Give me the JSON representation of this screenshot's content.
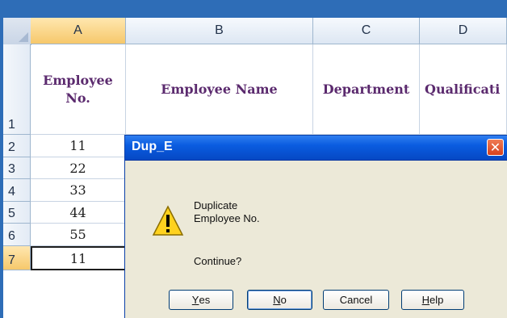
{
  "spreadsheet": {
    "columns": [
      "A",
      "B",
      "C",
      "D"
    ],
    "rows": [
      "1",
      "2",
      "3",
      "4",
      "5",
      "6",
      "7"
    ],
    "headers": {
      "employee_no_line1": "Employee",
      "employee_no_line2": "No.",
      "employee_name": "Employee Name",
      "department": "Department",
      "qualification": "Qualificati"
    },
    "employee_numbers": [
      "11",
      "22",
      "33",
      "44",
      "55",
      "11"
    ]
  },
  "dialog": {
    "title": "Dup_E",
    "message_line1": "Duplicate",
    "message_line2": "Employee No.",
    "question": "Continue?",
    "buttons": {
      "yes": {
        "accel": "Y",
        "rest": "es"
      },
      "no": {
        "accel": "N",
        "rest": "o"
      },
      "cancel": "Cancel",
      "help": {
        "accel": "H",
        "rest": "elp"
      }
    },
    "close_icon": "close-icon",
    "warning_icon": "warning-icon"
  },
  "colors": {
    "titlebar": "#0a5ce0",
    "header_text": "#5b2a6e",
    "selected_header": "#f6c86b"
  }
}
